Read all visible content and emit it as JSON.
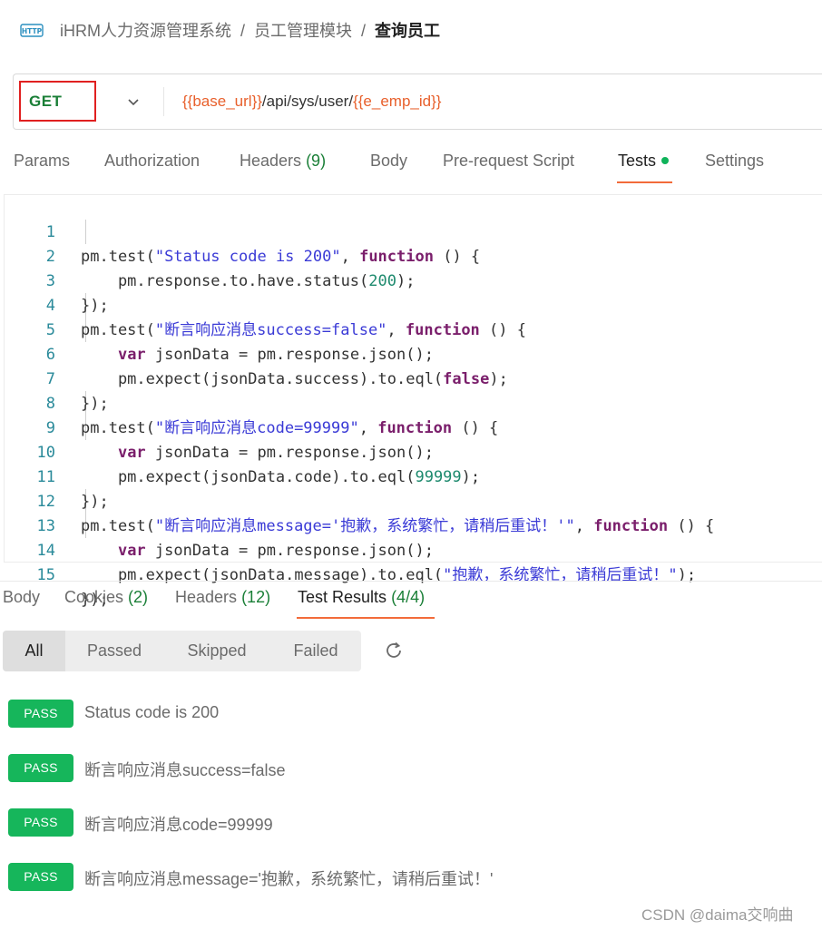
{
  "breadcrumb": {
    "icon": "http-icon",
    "items": [
      "iHRM人力资源管理系统",
      "员工管理模块"
    ],
    "current": "查询员工",
    "separator": "/"
  },
  "request": {
    "method": "GET",
    "url_parts": [
      "{{base_url}}",
      "/api/sys/user/",
      "{{e_emp_id}}"
    ]
  },
  "request_tabs": {
    "params": "Params",
    "authorization": "Authorization",
    "headers": "Headers",
    "headers_count": "(9)",
    "body": "Body",
    "prerequest": "Pre-request Script",
    "tests": "Tests",
    "settings": "Settings",
    "active": "Tests"
  },
  "code": {
    "line_numbers": [
      "1",
      "2",
      "3",
      "4",
      "5",
      "6",
      "7",
      "8",
      "9",
      "10",
      "11",
      "12",
      "13",
      "14",
      "15"
    ],
    "l1": {
      "a": "pm.test(",
      "s": "\"Status code is 200\"",
      "b": ", ",
      "kw": "function",
      "c": " () {"
    },
    "l2": {
      "a": "    pm.response.to.have.status(",
      "n": "200",
      "b": ");"
    },
    "l3": "});",
    "l4": {
      "a": "pm.test(",
      "s": "\"断言响应消息success=false\"",
      "b": ", ",
      "kw": "function",
      "c": " () {"
    },
    "l5": {
      "ind": "    ",
      "kw": "var",
      "rest": " jsonData = pm.response.json();"
    },
    "l6": {
      "a": "    pm.expect(jsonData.success).to.eql(",
      "kw": "false",
      "b": ");"
    },
    "l7": "});",
    "l8": {
      "a": "pm.test(",
      "s": "\"断言响应消息code=99999\"",
      "b": ", ",
      "kw": "function",
      "c": " () {"
    },
    "l9": {
      "ind": "    ",
      "kw": "var",
      "rest": " jsonData = pm.response.json();"
    },
    "l10": {
      "a": "    pm.expect(jsonData.code).to.eql(",
      "n": "99999",
      "b": ");"
    },
    "l11": "});",
    "l12": {
      "a": "pm.test(",
      "s": "\"断言响应消息message='抱歉，系统繁忙，请稍后重试！'\"",
      "b": ", ",
      "kw": "function",
      "c": " () {"
    },
    "l13": {
      "ind": "    ",
      "kw": "var",
      "rest": " jsonData = pm.response.json();"
    },
    "l14": {
      "a": "    pm.expect(jsonData.message).to.eql(",
      "s": "\"抱歉，系统繁忙，请稍后重试！\"",
      "b": ");"
    },
    "l15": "});"
  },
  "response_tabs": {
    "body": "Body",
    "cookies": "Cookies",
    "cookies_count": "(2)",
    "headers": "Headers",
    "headers_count": "(12)",
    "test_results": "Test Results",
    "test_results_count": "(4/4)",
    "active": "Test Results"
  },
  "filters": {
    "items": [
      "All",
      "Passed",
      "Skipped",
      "Failed"
    ],
    "selected": "All"
  },
  "results": [
    {
      "status": "PASS",
      "name": "Status code is 200"
    },
    {
      "status": "PASS",
      "name": "断言响应消息success=false"
    },
    {
      "status": "PASS",
      "name": "断言响应消息code=99999"
    },
    {
      "status": "PASS",
      "name": "断言响应消息message='抱歉，系统繁忙，请稍后重试！'"
    }
  ],
  "watermark": "CSDN @daima交响曲",
  "colors": {
    "accent": "#f26b3a",
    "pass": "#16b65b",
    "method": "#1a7f37",
    "variable": "#e8602c",
    "highlight_box": "#e02020"
  }
}
